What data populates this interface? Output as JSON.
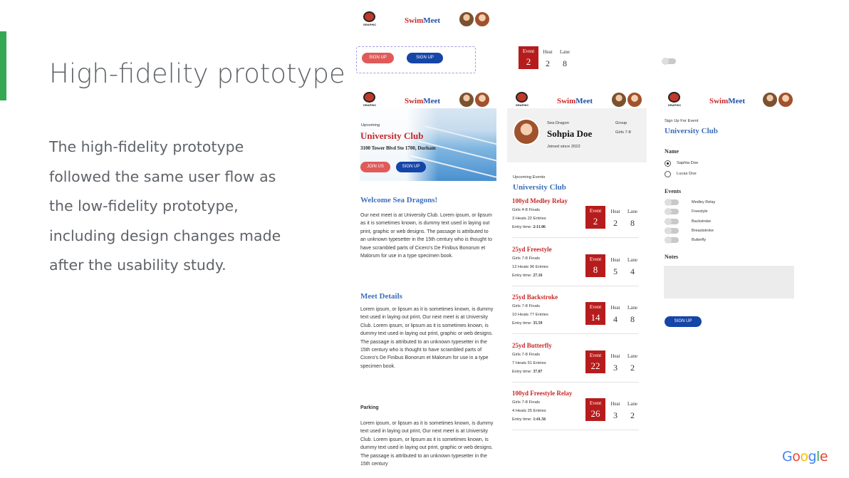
{
  "slide": {
    "title": "High-fidelity prototype",
    "body_lines": [
      "The high-fidelity prototype",
      "followed the same user flow as",
      "the low-fidelity prototype,",
      "including design changes made",
      "after the usability study."
    ],
    "accent_color": "#34a853"
  },
  "brand": {
    "swim": "Swim",
    "meet": "Meet",
    "logo_caption": "GRAPHIC",
    "logo_icon": "swim-club-logo"
  },
  "components": {
    "sign_up_red": "SIGN UP",
    "sign_up_blue": "SIGN UP",
    "event_label": "Event",
    "heat_label": "Heat",
    "lane_label": "Lane",
    "event_value": "2",
    "heat_value": "2",
    "lane_value": "8"
  },
  "home": {
    "upcoming_label": "Upcoming",
    "club_name": "University Club",
    "address": "3100 Tower Blvd Ste 1700, Durham",
    "join_button": "JOIN US",
    "signup_button": "SIGN UP",
    "welcome_title": "Welcome Sea Dragons!",
    "welcome_text": "Our next meet is at University Club. Lorem ipsum, or lipsum as it is sometimes known, is dummy text used in laying out print, graphic or web designs. The passage is attributed to an unknown typesetter in the 15th century who is thought to have scrambled parts of Cicero's De Finibus Bonorum et Malorum for use in a type specimen book.",
    "meet_details_title": "Meet Details",
    "meet_details_text": "Lorem ipsum, or lipsum as it is sometimes known, is dummy text used in laying out print, Our next meet is at University Club. Lorem ipsum, or lipsum as it is sometimes known, is dummy text used in laying out print, graphic or web designs. The passage is attributed to an unknown typesetter in the 15th century who is thought to have scrambled parts of Cicero's De Finibus Bonorum et Malorum for use in a type specimen book.",
    "parking_title": "Parking",
    "parking_text": "Lorem ipsum, or lipsum as it is sometimes known, is dummy text used in laying out print, Our next meet is at University Club. Lorem ipsum, or lipsum as it is sometimes known, is dummy text used in laying out print, graphic or web designs. The passage is attributed to an unknown typesetter in the 15th century"
  },
  "profile": {
    "team": "Sea Dragon",
    "name": "Sohpia Doe",
    "joined": "Joined since 2022",
    "group_label": "Group",
    "group_value": "Girls 7-8",
    "upcoming_label": "Upcoming Events",
    "club": "University Club",
    "events": [
      {
        "title": "100yd Medley Relay",
        "line1": "Girls 4-8 Finals",
        "line2": "3 Heats 22 Entries",
        "entry_label": "Entry time:",
        "entry_time": "2:11.06",
        "event": "2",
        "heat": "2",
        "lane": "8"
      },
      {
        "title": "25yd Freestyle",
        "line1": "Girls 7-8 Finals",
        "line2": "12 Heats 96 Entries",
        "entry_label": "Entry time:",
        "entry_time": "27.16",
        "event": "8",
        "heat": "5",
        "lane": "4"
      },
      {
        "title": "25yd Backstroke",
        "line1": "Girls 7-8 Finals",
        "line2": "10 Heats 77 Entries",
        "entry_label": "Entry time:",
        "entry_time": "35.59",
        "event": "14",
        "heat": "4",
        "lane": "8"
      },
      {
        "title": "25yd Butterfly",
        "line1": "Girls 7-8 Finals",
        "line2": "7 Heats 51 Entries",
        "entry_label": "Entry time:",
        "entry_time": "37.87",
        "event": "22",
        "heat": "3",
        "lane": "2"
      },
      {
        "title": "100yd Freestyle Relay",
        "line1": "Girls 7-8 Finals",
        "line2": "4 Heats 25 Entries",
        "entry_label": "Entry time:",
        "entry_time": "1:41.56",
        "event": "26",
        "heat": "3",
        "lane": "2"
      }
    ]
  },
  "signup": {
    "heading": "Sign Up For Event",
    "club": "University Club",
    "name_label": "Name",
    "names": [
      {
        "label": "Saphia Doe",
        "selected": true
      },
      {
        "label": "Lucas Doe",
        "selected": false
      }
    ],
    "events_label": "Events",
    "events": [
      "Medley Relay",
      "Freestyle",
      "Backstroke",
      "Breaststroke",
      "Butterfly"
    ],
    "notes_label": "Notes",
    "submit": "SIGN UP"
  },
  "footer": {
    "logo": "Google"
  }
}
